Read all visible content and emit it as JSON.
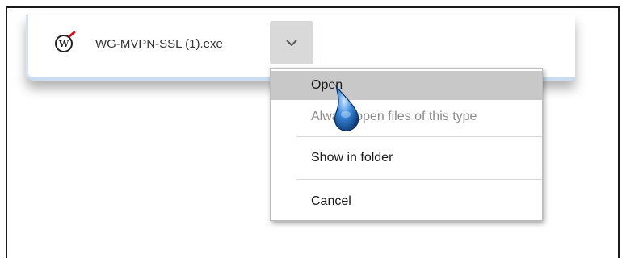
{
  "download": {
    "file_name": "WG-MVPN-SSL (1).exe",
    "file_icon": "watchguard-logo-icon",
    "menu_button_icon": "chevron-down-icon"
  },
  "context_menu": {
    "items": [
      {
        "label": "Open",
        "state": "highlighted"
      },
      {
        "label": "Always open files of this type",
        "state": "disabled"
      },
      {
        "label": "Show in folder",
        "state": "enabled"
      },
      {
        "label": "Cancel",
        "state": "enabled"
      }
    ]
  },
  "colors": {
    "menu_highlight": "#c8c8c8",
    "disabled_text": "#8a8a8a",
    "bar_accent": "#c9dcf1",
    "cursor_blue": "#2f7fcf"
  },
  "cursor": {
    "icon": "pointer-cursor-icon"
  }
}
